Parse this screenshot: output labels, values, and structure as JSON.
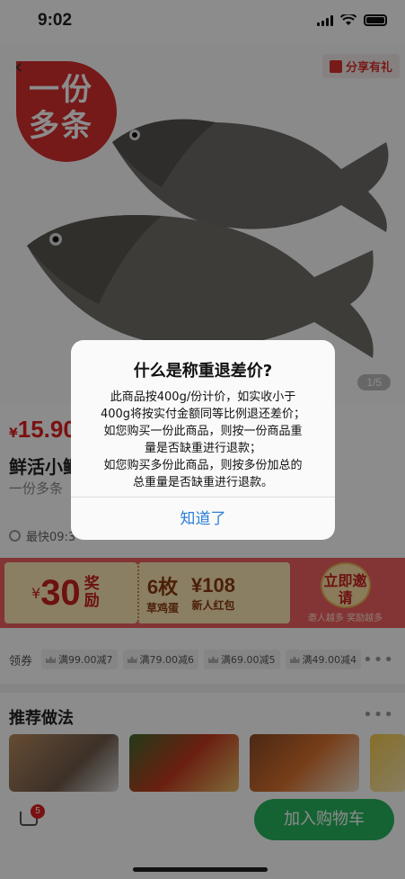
{
  "status_bar": {
    "time": "9:02"
  },
  "header": {
    "share_label": "分享有礼"
  },
  "hero": {
    "badge_text": "一份多条",
    "image_counter": "1/5"
  },
  "product": {
    "currency": "¥",
    "price": "15.90",
    "name": "鲜活小鲫",
    "subtitle": "一份多条",
    "delivery": "最快09:3"
  },
  "promo": {
    "coupon_currency": "¥",
    "coupon_amount": "30",
    "coupon_label": "奖励",
    "eggs_top": "6枚",
    "eggs_bottom": "草鸡蛋",
    "redpack_top": "¥108",
    "redpack_bottom": "新人红包",
    "invite_button": "立即邀请",
    "invite_sub": "邀人越多 奖励越多"
  },
  "coupons": {
    "label": "领券",
    "items": [
      "满99.00减7",
      "满79.00减6",
      "满69.00减5",
      "满49.00减4"
    ]
  },
  "recommend": {
    "title": "推荐做法"
  },
  "bottom_bar": {
    "cart_count": "5",
    "add_to_cart": "加入购物车"
  },
  "dialog": {
    "title": "什么是称重退差价?",
    "lines": [
      "此商品按400g/份计价，如实收小于",
      "400g将按实付金额同等比例退还差价；",
      "如您购买一份此商品，则按一份商品重",
      "量是否缺重进行退款；",
      "如您购买多份此商品，则按多份加总的",
      "总重量是否缺重进行退款。"
    ],
    "button": "知道了"
  }
}
